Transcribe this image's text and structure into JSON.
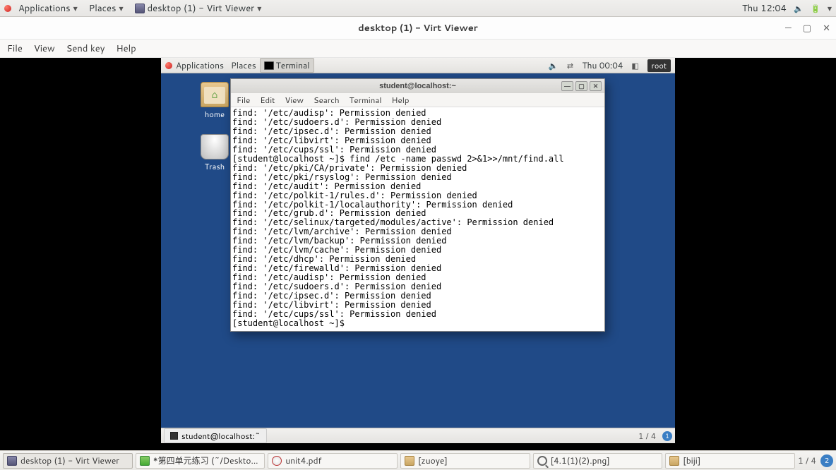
{
  "outer_panel": {
    "applications": "Applications",
    "places": "Places",
    "active_task": "desktop (1) - Virt Viewer",
    "clock": "Thu 12:04"
  },
  "virt_viewer": {
    "title": "desktop (1) - Virt Viewer",
    "menu": {
      "file": "File",
      "view": "View",
      "sendkey": "Send key",
      "help": "Help"
    }
  },
  "guest_panel": {
    "applications": "Applications",
    "places": "Places",
    "terminal_task": "Terminal",
    "clock": "Thu 00:04",
    "user": "root"
  },
  "desktop_icons": {
    "home": "home",
    "trash": "Trash"
  },
  "terminal": {
    "title": "student@localhost:~",
    "menu": {
      "file": "File",
      "edit": "Edit",
      "view": "View",
      "search": "Search",
      "terminal": "Terminal",
      "help": "Help"
    },
    "lines": [
      "find: '/etc/audisp': Permission denied",
      "find: '/etc/sudoers.d': Permission denied",
      "find: '/etc/ipsec.d': Permission denied",
      "find: '/etc/libvirt': Permission denied",
      "find: '/etc/cups/ssl': Permission denied",
      "[student@localhost ~]$ find /etc -name passwd 2>&1>>/mnt/find.all",
      "find: '/etc/pki/CA/private': Permission denied",
      "find: '/etc/pki/rsyslog': Permission denied",
      "find: '/etc/audit': Permission denied",
      "find: '/etc/polkit-1/rules.d': Permission denied",
      "find: '/etc/polkit-1/localauthority': Permission denied",
      "find: '/etc/grub.d': Permission denied",
      "find: '/etc/selinux/targeted/modules/active': Permission denied",
      "find: '/etc/lvm/archive': Permission denied",
      "find: '/etc/lvm/backup': Permission denied",
      "find: '/etc/lvm/cache': Permission denied",
      "find: '/etc/dhcp': Permission denied",
      "find: '/etc/firewalld': Permission denied",
      "find: '/etc/audisp': Permission denied",
      "find: '/etc/sudoers.d': Permission denied",
      "find: '/etc/ipsec.d': Permission denied",
      "find: '/etc/libvirt': Permission denied",
      "find: '/etc/cups/ssl': Permission denied",
      "[student@localhost ~]$ "
    ]
  },
  "guest_taskbar": {
    "task": "student@localhost:~",
    "pager": "1 / 4"
  },
  "outer_taskbar": {
    "t0": "desktop (1) - Virt Viewer",
    "t1": "*第四单元练习 (~/Deskto...",
    "t2": "unit4.pdf",
    "t3": "[zuoye]",
    "t4": "[4.1(1)(2).png]",
    "t5": "[biji]",
    "pager": "1 / 4"
  }
}
